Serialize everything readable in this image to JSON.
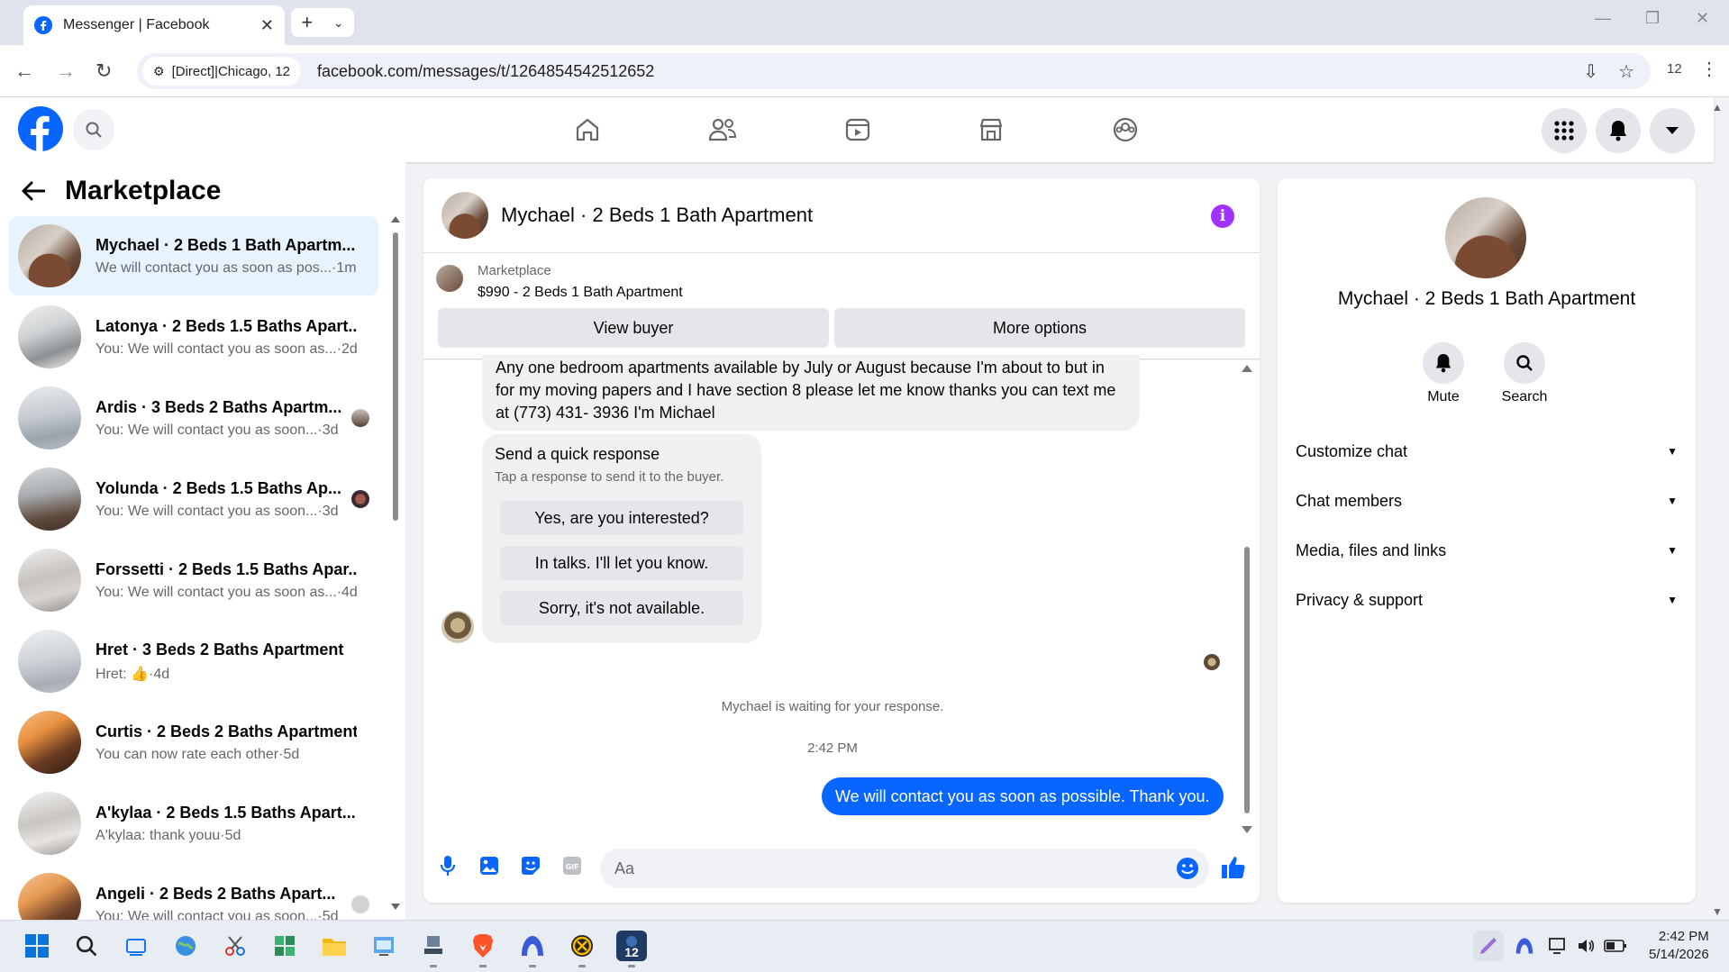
{
  "browser": {
    "tab_title": "Messenger | Facebook",
    "site_chip": "[Direct]|Chicago, 12",
    "url": "facebook.com/messages/t/1264854542512652",
    "extension_count": "12"
  },
  "fb": {
    "brand_color": "#0866ff",
    "nav_icons": [
      "home-icon",
      "friends-icon",
      "video-icon",
      "marketplace-icon",
      "groups-icon"
    ]
  },
  "sidebar": {
    "title": "Marketplace",
    "conversations": [
      {
        "name": "Mychael · 2 Beds 1 Bath Apartm...",
        "preview": "We will contact you as soon as pos...·1m",
        "active": true
      },
      {
        "name": "Latonya · 2 Beds 1.5 Baths Apart...",
        "preview": "You: We will contact you as soon as...·2d"
      },
      {
        "name": "Ardis · 3 Beds 2 Baths Apartm...",
        "preview": "You: We will contact you as soon...·3d"
      },
      {
        "name": "Yolunda · 2 Beds 1.5 Baths Ap...",
        "preview": "You: We will contact you as soon...·3d"
      },
      {
        "name": "Forssetti · 2 Beds 1.5 Baths Apar...",
        "preview": "You: We will contact you as soon as...·4d"
      },
      {
        "name": "Hret · 3 Beds 2 Baths Apartment",
        "preview_prefix": "Hret:",
        "preview_suffix": "·4d"
      },
      {
        "name": "Curtis · 2 Beds 2 Baths Apartment",
        "preview": "You can now rate each other·5d"
      },
      {
        "name": "A'kylaa · 2 Beds 1.5 Baths Apart...",
        "preview": "A'kylaa: thank youu·5d"
      },
      {
        "name": "Angeli · 2 Beds 2 Baths Apart...",
        "preview": "You: We will contact you as soon...·5d"
      }
    ]
  },
  "chat": {
    "title": "Mychael · 2 Beds 1 Bath Apartment",
    "listing_source": "Marketplace",
    "listing_price": "$990 - 2 Beds 1 Bath Apartment",
    "view_buyer": "View buyer",
    "more_options": "More options",
    "incoming_message": "Any one bedroom apartments available by July or August because I'm about to but in for my moving papers and I have section 8 please let me know thanks you can text me at (773) 431- 3936 I'm Michael",
    "quick_response": {
      "title": "Send a quick response",
      "subtitle": "Tap a response to send it to the buyer.",
      "options": [
        "Yes, are you interested?",
        "In talks. I'll let you know.",
        "Sorry, it's not available."
      ]
    },
    "waiting_text": "Mychael is waiting for your response.",
    "timestamp": "2:42 PM",
    "outgoing_message": "We will contact you as soon as possible. Thank you.",
    "input_placeholder": "Aa"
  },
  "details": {
    "name": "Mychael · 2 Beds 1 Bath Apartment",
    "mute": "Mute",
    "search": "Search",
    "sections": [
      "Customize chat",
      "Chat members",
      "Media, files and links",
      "Privacy & support"
    ]
  },
  "taskbar": {
    "time": "2:42 PM",
    "date": "5/14/2026",
    "badge": "12"
  }
}
